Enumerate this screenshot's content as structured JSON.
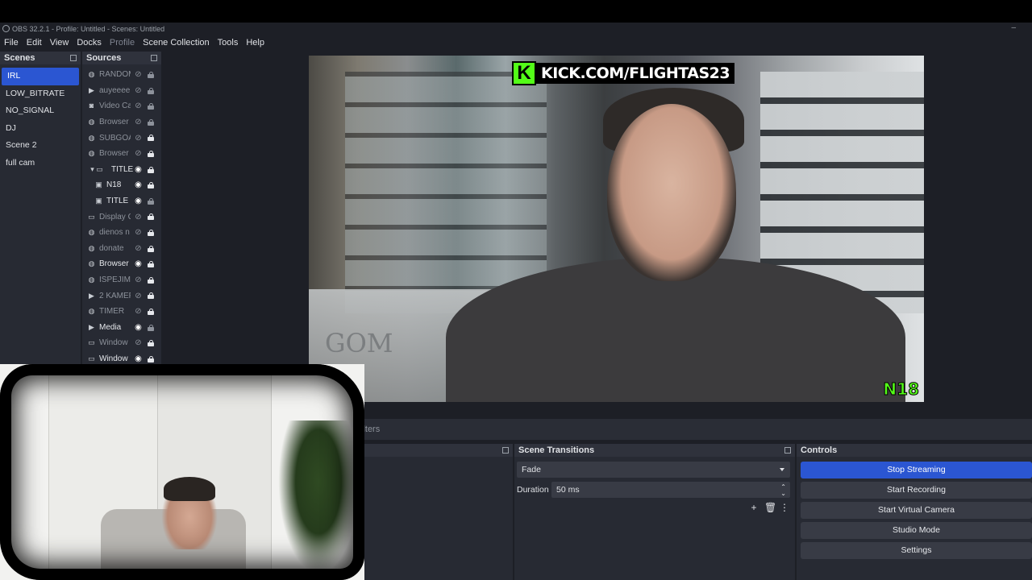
{
  "window": {
    "title": "OBS 32.2.1 - Profile: Untitled - Scenes: Untitled",
    "minimize": "–"
  },
  "menu": [
    "File",
    "Edit",
    "View",
    "Docks",
    "Profile",
    "Scene Collection",
    "Tools",
    "Help"
  ],
  "scenes": {
    "title": "Scenes",
    "items": [
      "IRL",
      "LOW_BITRATE",
      "NO_SIGNAL",
      "DJ",
      "Scene 2",
      "full cam"
    ],
    "selected": "IRL"
  },
  "sources": {
    "title": "Sources",
    "items": [
      {
        "name": "RANDOM",
        "icon": "browser-icon",
        "glyph": "◍",
        "visible": false,
        "locked": false
      },
      {
        "name": "auyeeee",
        "icon": "media-icon",
        "glyph": "▶",
        "visible": false,
        "locked": false
      },
      {
        "name": "Video Ca",
        "icon": "camera-icon",
        "glyph": "◙",
        "visible": false,
        "locked": false
      },
      {
        "name": "Browser",
        "icon": "browser-icon",
        "glyph": "◍",
        "visible": false,
        "locked": false
      },
      {
        "name": "SUBGOA",
        "icon": "browser-icon",
        "glyph": "◍",
        "visible": false,
        "locked": true
      },
      {
        "name": "Browser",
        "icon": "browser-icon",
        "glyph": "◍",
        "visible": false,
        "locked": true
      },
      {
        "name": "TITLE",
        "icon": "group-folder-icon",
        "glyph": "▾ ▭",
        "visible": true,
        "locked": true
      },
      {
        "name": "N18",
        "icon": "image-icon",
        "glyph": "▣",
        "visible": true,
        "locked": true
      },
      {
        "name": "TITLE",
        "icon": "image-icon",
        "glyph": "▣",
        "visible": true,
        "locked": false
      },
      {
        "name": "Display C",
        "icon": "display-icon",
        "glyph": "▭",
        "visible": false,
        "locked": true
      },
      {
        "name": "dienos n",
        "icon": "browser-icon",
        "glyph": "◍",
        "visible": false,
        "locked": true
      },
      {
        "name": "donate",
        "icon": "browser-icon",
        "glyph": "◍",
        "visible": false,
        "locked": true
      },
      {
        "name": "Browser",
        "icon": "browser-icon",
        "glyph": "◍",
        "visible": true,
        "locked": true
      },
      {
        "name": "ISPEJIMA",
        "icon": "browser-icon",
        "glyph": "◍",
        "visible": false,
        "locked": true
      },
      {
        "name": "2 KAMEF",
        "icon": "media-icon",
        "glyph": "▶",
        "visible": false,
        "locked": true
      },
      {
        "name": "TIMER",
        "icon": "browser-icon",
        "glyph": "◍",
        "visible": false,
        "locked": true
      },
      {
        "name": "Media",
        "icon": "media-icon",
        "glyph": "▶",
        "visible": true,
        "locked": false
      },
      {
        "name": "Window",
        "icon": "window-icon",
        "glyph": "▭",
        "visible": false,
        "locked": true
      },
      {
        "name": "Window",
        "icon": "window-icon",
        "glyph": "▭",
        "visible": true,
        "locked": true
      }
    ]
  },
  "preview": {
    "banner_k": "K",
    "banner_text": "KICK.COM/FLIGHTAS23",
    "corner_logo": "N18",
    "window_letters": "GOM"
  },
  "filters": {
    "label": "ilters"
  },
  "transitions": {
    "title": "Scene Transitions",
    "selected": "Fade",
    "duration_label": "Duration",
    "duration_value": "50 ms"
  },
  "controls": {
    "title": "Controls",
    "buttons": [
      "Stop Streaming",
      "Start Recording",
      "Start Virtual Camera",
      "Studio Mode",
      "Settings"
    ]
  },
  "colors": {
    "accent": "#2b56d2",
    "kick_green": "#53fc18",
    "panel": "#272a33",
    "background": "#1d1f26"
  }
}
